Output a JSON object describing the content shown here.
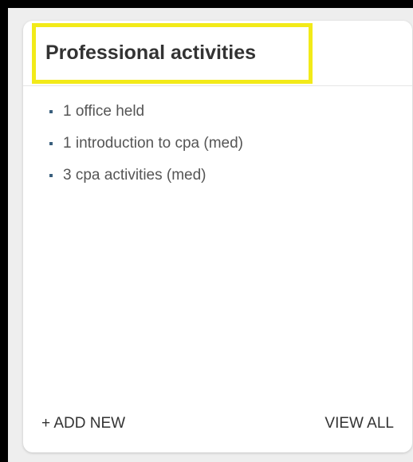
{
  "card": {
    "title": "Professional activities",
    "highlight_color": "#f2ea19",
    "bullet_color": "#3a5f7d",
    "items": [
      {
        "label": "1 office held"
      },
      {
        "label": "1 introduction to cpa (med)"
      },
      {
        "label": "3 cpa activities (med)"
      }
    ],
    "footer": {
      "add_new_label": "+ ADD NEW",
      "view_all_label": "VIEW ALL"
    }
  }
}
